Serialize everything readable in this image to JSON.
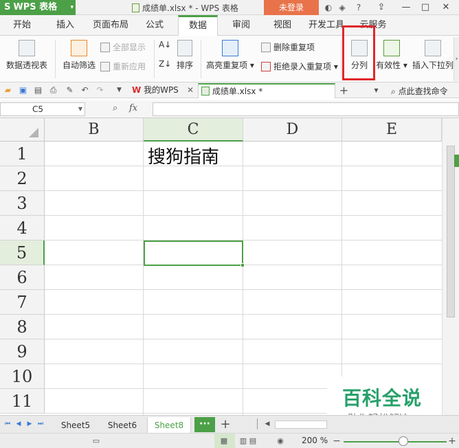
{
  "titlebar": {
    "app_name": "WPS 表格",
    "doc_title": "成绩单.xlsx * - WPS 表格",
    "login_label": "未登录",
    "icons": [
      "skin-icon",
      "feedback-icon",
      "help-icon",
      "restore-window-icon",
      "minimize-icon",
      "maximize-icon",
      "close-icon"
    ]
  },
  "tabs": [
    {
      "label": "开始"
    },
    {
      "label": "插入"
    },
    {
      "label": "页面布局"
    },
    {
      "label": "公式"
    },
    {
      "label": "数据",
      "active": true
    },
    {
      "label": "审阅"
    },
    {
      "label": "视图"
    },
    {
      "label": "开发工具"
    },
    {
      "label": "云服务"
    }
  ],
  "ribbon": {
    "pivot_table": "数据透视表",
    "auto_filter": "自动筛选",
    "show_all": "全部显示",
    "reapply": "重新应用",
    "sort": "排序",
    "highlight_duplicates": "高亮重复项",
    "delete_duplicates": "删除重复项",
    "reject_duplicates": "拒绝录入重复项",
    "text_to_columns": "分列",
    "validity": "有效性",
    "insert_dropdown": "插入下拉列"
  },
  "quickbar": {
    "doc_tabs": [
      {
        "label": "我的WPS"
      },
      {
        "label": "成绩单.xlsx *",
        "active": true
      }
    ],
    "search_label": "点此查找命令"
  },
  "formula_bar": {
    "name_box": "C5",
    "fx_label": "fx",
    "content": ""
  },
  "grid": {
    "columns": [
      "B",
      "C",
      "D",
      "E"
    ],
    "selected_column": "C",
    "rows": [
      "1",
      "2",
      "3",
      "4",
      "5",
      "6",
      "7",
      "8",
      "9",
      "10",
      "11"
    ],
    "selected_row": "5",
    "cells": {
      "C1": "搜狗指南"
    }
  },
  "watermark": {
    "title": "百科全说",
    "subtitle": "助你轻松解决"
  },
  "sheets": [
    {
      "label": "Sheet5"
    },
    {
      "label": "Sheet6"
    },
    {
      "label": "Sheet8",
      "active": true
    }
  ],
  "statusbar": {
    "zoom": "200 %"
  },
  "colors": {
    "accent": "#4ca047",
    "login": "#e8734a",
    "highlight_box": "#e0262b",
    "watermark": "#27a06a"
  }
}
